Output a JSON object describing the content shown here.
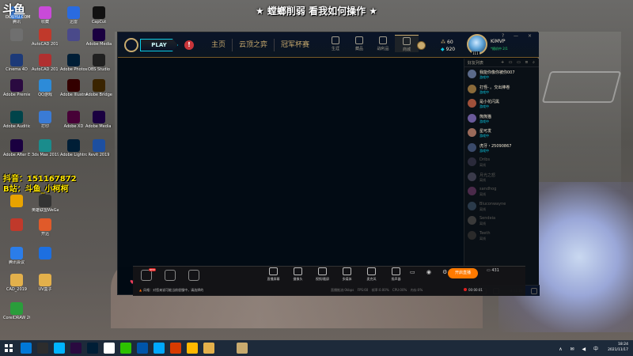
{
  "overlay": {
    "title": "★ 螳螂削弱 看我如何操作 ★",
    "douyu_logo": "斗鱼",
    "douyu_sub": "DOUYU.COM",
    "streamer_line1": "抖音：151167872",
    "streamer_line2": "B站：斗鱼_小柯柯"
  },
  "desktop_icons": [
    {
      "label": "腾讯",
      "icon": "app-icon",
      "color": "#3a7bd5"
    },
    {
      "label": "",
      "icon": "app-icon",
      "color": "#6f6f6f"
    },
    {
      "label": "Cinema 4D",
      "icon": "cinema4d-icon",
      "color": "#1d3a78"
    },
    {
      "label": "Adobe Premiere",
      "icon": "premiere-icon",
      "color": "#2a0a40"
    },
    {
      "label": "Adobe Audition",
      "icon": "audition-icon",
      "color": "#00444a"
    },
    {
      "label": "Adobe After Effects",
      "icon": "aftereffects-icon",
      "color": "#1a0040"
    },
    {
      "label": "",
      "icon": "app-icon",
      "color": "#e8a300"
    },
    {
      "label": "",
      "icon": "app-icon",
      "color": "#c0392b"
    },
    {
      "label": "腾讯会议",
      "icon": "app-icon",
      "color": "#2b7de9"
    },
    {
      "label": "CAD_2019",
      "icon": "folder-icon",
      "color": "#e3b04b"
    },
    {
      "label": "CorelDRAW 2020 (64-Bit)",
      "icon": "coreldraw-icon",
      "color": "#2a9d3b"
    },
    {
      "label": "收藏",
      "icon": "app-icon",
      "color": "#c94ad8"
    },
    {
      "label": "AutoCAD 2019 - 简体中文",
      "icon": "autocad-icon",
      "color": "#c0392b"
    },
    {
      "label": "AutoCAD 2019",
      "icon": "autocad-icon",
      "color": "#b03030"
    },
    {
      "label": "QQ游戏",
      "icon": "app-icon",
      "color": "#2d8bd8"
    },
    {
      "label": "打印",
      "icon": "app-icon",
      "color": "#3a7bd5"
    },
    {
      "label": "3ds Max 2019",
      "icon": "3dsmax-icon",
      "color": "#1a8c8c"
    },
    {
      "label": "英雄联盟WeGame版",
      "icon": "app-icon",
      "color": "#333"
    },
    {
      "label": "开迅",
      "icon": "app-icon",
      "color": "#e05a2a"
    },
    {
      "label": "",
      "icon": "app-icon",
      "color": "#1d6fe0"
    },
    {
      "label": "UV盒子",
      "icon": "app-icon",
      "color": "#e3b04b"
    },
    {
      "label": "迅雷",
      "icon": "xunlei-icon",
      "color": "#2a6be0"
    },
    {
      "label": "",
      "icon": "app-icon",
      "color": "#4a4a8a"
    },
    {
      "label": "Adobe Photoshop",
      "icon": "photoshop-icon",
      "color": "#001e36"
    },
    {
      "label": "Adobe Illustrator",
      "icon": "illustrator-icon",
      "color": "#330000"
    },
    {
      "label": "Adobe XD",
      "icon": "xd-icon",
      "color": "#470137"
    },
    {
      "label": "Adobe Lightroom",
      "icon": "lightroom-icon",
      "color": "#001e36"
    },
    {
      "label": "CapCut",
      "icon": "app-icon",
      "color": "#111"
    },
    {
      "label": "Adobe Media",
      "icon": "media-icon",
      "color": "#1a0040"
    },
    {
      "label": "OBS Studio",
      "icon": "obs-icon",
      "color": "#202020"
    },
    {
      "label": "Adobe Bridge",
      "icon": "bridge-icon",
      "color": "#3a2400"
    },
    {
      "label": "Adobe Media Encoder",
      "icon": "encoder-icon",
      "color": "#1a0040"
    },
    {
      "label": "Revit 2019",
      "icon": "revit-icon",
      "color": "#1d4fa0"
    }
  ],
  "client": {
    "play_label": "PLAY",
    "alert_glyph": "!",
    "nav": [
      "主页",
      "云顶之弈",
      "冠军杯赛"
    ],
    "tools": [
      {
        "label": "生涯",
        "icon": "profile-icon"
      },
      {
        "label": "藏品",
        "icon": "collection-icon"
      },
      {
        "label": "战利品",
        "icon": "loot-icon"
      },
      {
        "label": "商城",
        "icon": "store-icon"
      }
    ],
    "rp": "60",
    "be": "920",
    "rp_glyph": "⁂",
    "be_glyph": "◆",
    "player_name": "KiMVP",
    "player_status": "*随机中 2/1",
    "level": "111",
    "window_controls": "? — ×"
  },
  "social": {
    "header": "好友列表",
    "header_icons": "+ ▭ ▭ ≡ ⌕",
    "friends": [
      {
        "name": "我能你像你被你007",
        "status": "游戏中",
        "state": "ingame",
        "avatar": "#5a6a8a"
      },
      {
        "name": "打怪- 。交出棒卷",
        "status": "游戏中",
        "state": "ingame",
        "avatar": "#8a6a3a"
      },
      {
        "name": "是小花闪黑",
        "status": "游戏中",
        "state": "ingame",
        "avatar": "#a0503a"
      },
      {
        "name": "熊熊猫",
        "status": "游戏中",
        "state": "ingame",
        "avatar": "#6a5a9a"
      },
      {
        "name": "星可发",
        "status": "游戏中",
        "state": "ingame",
        "avatar": "#9a6a5a"
      },
      {
        "name": "虎牙・25090867",
        "status": "游戏中",
        "state": "ingame",
        "avatar": "#3a4a6a"
      },
      {
        "name": "Dribs",
        "status": "离线",
        "state": "offline",
        "avatar": "#2a2a3a"
      },
      {
        "name": "月光之怒",
        "status": "离线",
        "state": "offline",
        "avatar": "#3a3a4a"
      },
      {
        "name": "sandhog",
        "status": "离线",
        "state": "offline",
        "avatar": "#4a2a4a"
      },
      {
        "name": "Bluconwayne",
        "status": "离线",
        "state": "offline",
        "avatar": "#2a3a4a"
      },
      {
        "name": "Sendeia",
        "status": "离线",
        "state": "offline",
        "avatar": "#3a3a3a"
      },
      {
        "name": "Teeth",
        "status": "离线",
        "state": "offline",
        "avatar": "#2a2a2a"
      }
    ],
    "version": "4:11:24"
  },
  "stream_bar": {
    "badge": "NEW",
    "tools": [
      {
        "label": "直播屏幕",
        "icon": "screen-icon"
      },
      {
        "label": "摄像头",
        "icon": "camera-icon"
      },
      {
        "label": "视频/截屏",
        "icon": "video-icon"
      },
      {
        "label": "多媒体",
        "icon": "media-icon"
      },
      {
        "label": "麦克风",
        "icon": "microphone-icon"
      },
      {
        "label": "扬声器",
        "icon": "speaker-icon"
      }
    ],
    "icons_row": "▭ ◉ ⚙",
    "live_label": "开启直播",
    "viewers": "431",
    "notice_icon": "▲",
    "notice": "风格：对您来说可能当前很慢中，请选择的",
    "stats": "直播推流:0kbps FPS:60 帧率:0.00% CPU:00% 内存:0%",
    "timer": "00:00:01"
  },
  "taskbar": {
    "apps": [
      "#0078d7",
      "#2d2d2d",
      "#00b4ff",
      "#2a0a40",
      "#001e36",
      "#ffffff",
      "#2dc100",
      "#0055aa",
      "#00a8ff",
      "#d83b01",
      "#ffb900",
      "#e3b04b",
      "#1d2a3a",
      "#c8aa6e"
    ],
    "tray": "∧ ✉ ◀ 中",
    "time": "18:24",
    "date": "2021/11/17"
  }
}
